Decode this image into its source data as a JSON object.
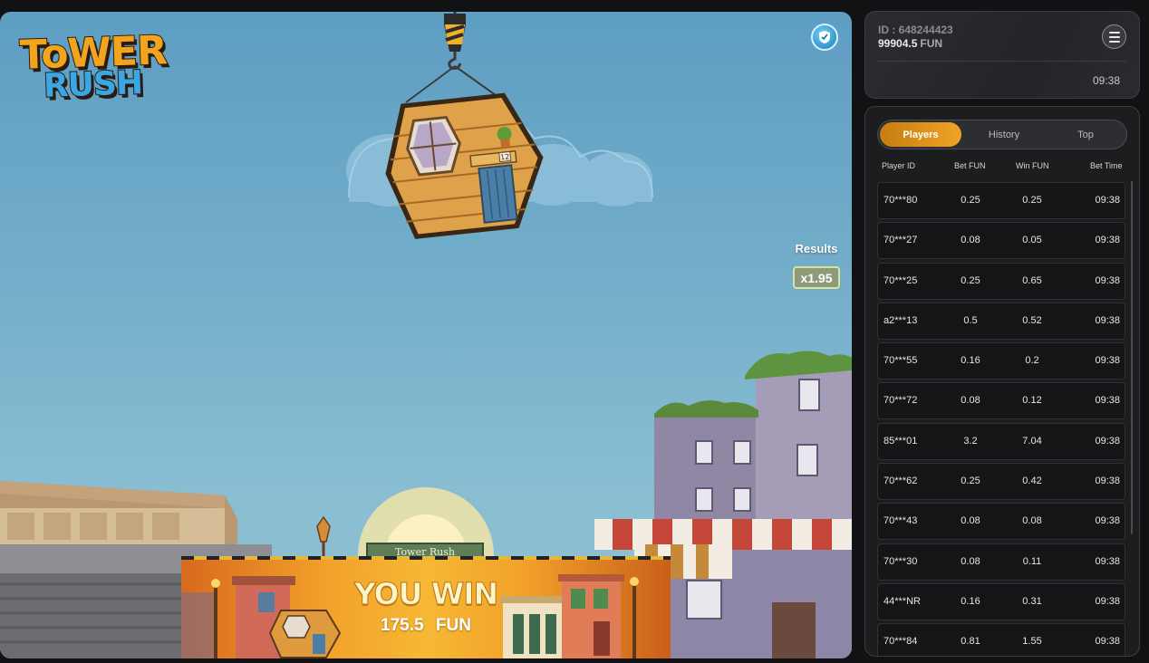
{
  "game": {
    "logo_line1": "ToWER",
    "logo_line2": "RUSH",
    "results_label": "Results",
    "results_value": "x1.95",
    "sign_text": "Tower Rush",
    "block_number": "12",
    "win": {
      "title": "YOU WIN",
      "amount": "175.5",
      "currency": "FUN"
    }
  },
  "account": {
    "id": "ID : 648244423",
    "balance": "99904.5",
    "currency": "FUN",
    "time": "09:38"
  },
  "tabs": [
    {
      "label": "Players",
      "active": true
    },
    {
      "label": "History",
      "active": false
    },
    {
      "label": "Top",
      "active": false
    }
  ],
  "columns": {
    "player": "Player ID",
    "bet": "Bet  FUN",
    "win": "Win  FUN",
    "time": "Bet Time"
  },
  "rows": [
    {
      "id": "70***80",
      "bet": "0.25",
      "win": "0.25",
      "time": "09:38"
    },
    {
      "id": "70***27",
      "bet": "0.08",
      "win": "0.05",
      "time": "09:38"
    },
    {
      "id": "70***25",
      "bet": "0.25",
      "win": "0.65",
      "time": "09:38"
    },
    {
      "id": "a2***13",
      "bet": "0.5",
      "win": "0.52",
      "time": "09:38"
    },
    {
      "id": "70***55",
      "bet": "0.16",
      "win": "0.2",
      "time": "09:38"
    },
    {
      "id": "70***72",
      "bet": "0.08",
      "win": "0.12",
      "time": "09:38"
    },
    {
      "id": "85***01",
      "bet": "3.2",
      "win": "7.04",
      "time": "09:38"
    },
    {
      "id": "70***62",
      "bet": "0.25",
      "win": "0.42",
      "time": "09:38"
    },
    {
      "id": "70***43",
      "bet": "0.08",
      "win": "0.08",
      "time": "09:38"
    },
    {
      "id": "70***30",
      "bet": "0.08",
      "win": "0.11",
      "time": "09:38"
    },
    {
      "id": "44***NR",
      "bet": "0.16",
      "win": "0.31",
      "time": "09:38"
    },
    {
      "id": "70***84",
      "bet": "0.81",
      "win": "1.55",
      "time": "09:38"
    }
  ],
  "colors": {
    "accent": "#f0a326",
    "sky": "#73adc9",
    "panel": "#1c1d1f"
  }
}
